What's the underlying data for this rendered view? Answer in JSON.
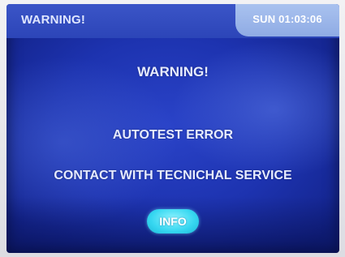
{
  "header": {
    "title": "WARNING!",
    "clock": "SUN 01:03:06"
  },
  "message": {
    "heading": "WARNING!",
    "line1": "AUTOTEST ERROR",
    "line2": "CONTACT WITH TECNICHAL SERVICE"
  },
  "actions": {
    "info_label": "INFO"
  },
  "colors": {
    "screen_background": "#1d33b0",
    "header_bar": "#2c45b8",
    "clock_badge": "#a9c2ef",
    "info_button": "#35d6f0"
  }
}
